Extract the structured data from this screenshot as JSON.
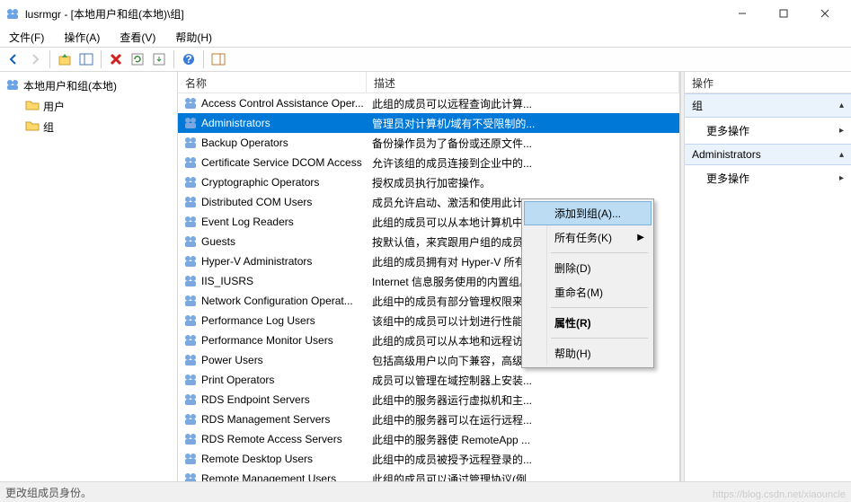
{
  "window": {
    "title": "lusrmgr - [本地用户和组(本地)\\组]"
  },
  "menubar": {
    "file": "文件(F)",
    "action": "操作(A)",
    "view": "查看(V)",
    "help": "帮助(H)"
  },
  "tree": {
    "root": "本地用户和组(本地)",
    "users": "用户",
    "groups": "组"
  },
  "columns": {
    "name": "名称",
    "description": "描述"
  },
  "groups": {
    "items": [
      {
        "name": "Access Control Assistance Oper...",
        "desc": "此组的成员可以远程查询此计算..."
      },
      {
        "name": "Administrators",
        "desc": "管理员对计算机/域有不受限制的..."
      },
      {
        "name": "Backup Operators",
        "desc": "备份操作员为了备份或还原文件..."
      },
      {
        "name": "Certificate Service DCOM Access",
        "desc": "允许该组的成员连接到企业中的..."
      },
      {
        "name": "Cryptographic Operators",
        "desc": "授权成员执行加密操作。"
      },
      {
        "name": "Distributed COM Users",
        "desc": "成员允许启动、激活和使用此计..."
      },
      {
        "name": "Event Log Readers",
        "desc": "此组的成员可以从本地计算机中..."
      },
      {
        "name": "Guests",
        "desc": "按默认值，来宾跟用户组的成员..."
      },
      {
        "name": "Hyper-V Administrators",
        "desc": "此组的成员拥有对 Hyper-V 所有..."
      },
      {
        "name": "IIS_IUSRS",
        "desc": "Internet 信息服务使用的内置组。"
      },
      {
        "name": "Network Configuration Operat...",
        "desc": "此组中的成员有部分管理权限来..."
      },
      {
        "name": "Performance Log Users",
        "desc": "该组中的成员可以计划进行性能..."
      },
      {
        "name": "Performance Monitor Users",
        "desc": "此组的成员可以从本地和远程访..."
      },
      {
        "name": "Power Users",
        "desc": "包括高级用户以向下兼容，高级..."
      },
      {
        "name": "Print Operators",
        "desc": "成员可以管理在域控制器上安装..."
      },
      {
        "name": "RDS Endpoint Servers",
        "desc": "此组中的服务器运行虚拟机和主..."
      },
      {
        "name": "RDS Management Servers",
        "desc": "此组中的服务器可以在运行远程..."
      },
      {
        "name": "RDS Remote Access Servers",
        "desc": "此组中的服务器使 RemoteApp ..."
      },
      {
        "name": "Remote Desktop Users",
        "desc": "此组中的成员被授予远程登录的..."
      },
      {
        "name": "Remote Management Users",
        "desc": "此组的成员可以通过管理协议(例..."
      }
    ]
  },
  "selected_index": 1,
  "context_menu": {
    "add_to_group": "添加到组(A)...",
    "all_tasks": "所有任务(K)",
    "delete": "删除(D)",
    "rename": "重命名(M)",
    "properties": "属性(R)",
    "help": "帮助(H)"
  },
  "actions": {
    "header": "操作",
    "group_section": "组",
    "more_actions": "更多操作",
    "selected_section": "Administrators"
  },
  "statusbar": {
    "text": "更改组成员身份。"
  },
  "watermark": "https://blog.csdn.net/xiaouncle"
}
